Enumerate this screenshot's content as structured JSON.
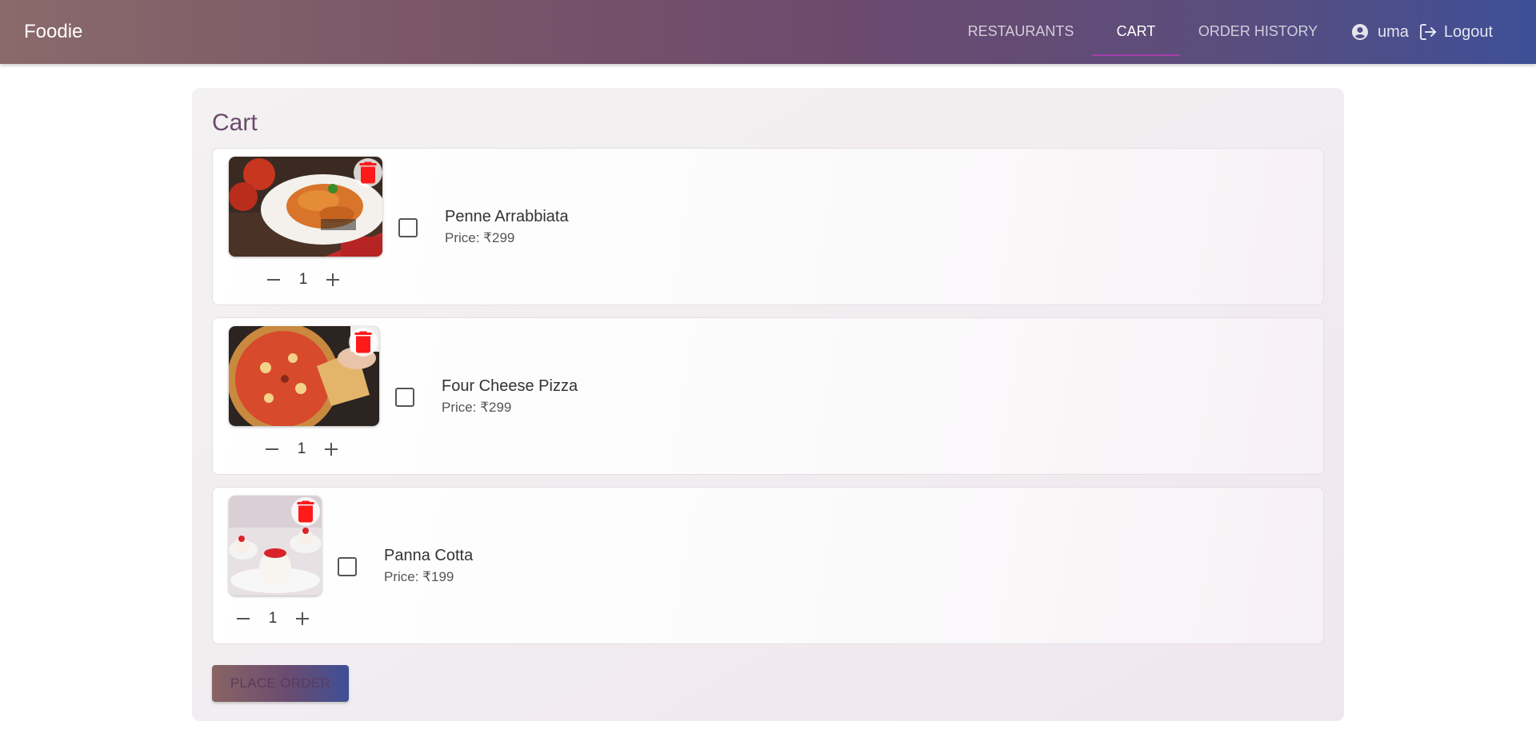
{
  "header": {
    "brand": "Foodie",
    "tabs": [
      {
        "label": "RESTAURANTS",
        "active": false
      },
      {
        "label": "CART",
        "active": true
      },
      {
        "label": "ORDER HISTORY",
        "active": false
      }
    ],
    "user_name": "uma",
    "logout_label": "Logout"
  },
  "cart": {
    "title": "Cart",
    "items": [
      {
        "name": "Penne Arrabbiata",
        "price": "Price: ₹299",
        "quantity": "1",
        "checked": false,
        "image_icon": "pasta-photo"
      },
      {
        "name": "Four Cheese Pizza",
        "price": "Price: ₹299",
        "quantity": "1",
        "checked": false,
        "image_icon": "pizza-photo"
      },
      {
        "name": "Panna Cotta",
        "price": "Price: ₹199",
        "quantity": "1",
        "checked": false,
        "image_icon": "panna-cotta-photo"
      }
    ],
    "place_order_label": "PLACE ORDER"
  },
  "colors": {
    "accent_underline": "#a53fa8",
    "delete_icon": "#ff1a1a",
    "title_color": "#6b4b6b"
  }
}
